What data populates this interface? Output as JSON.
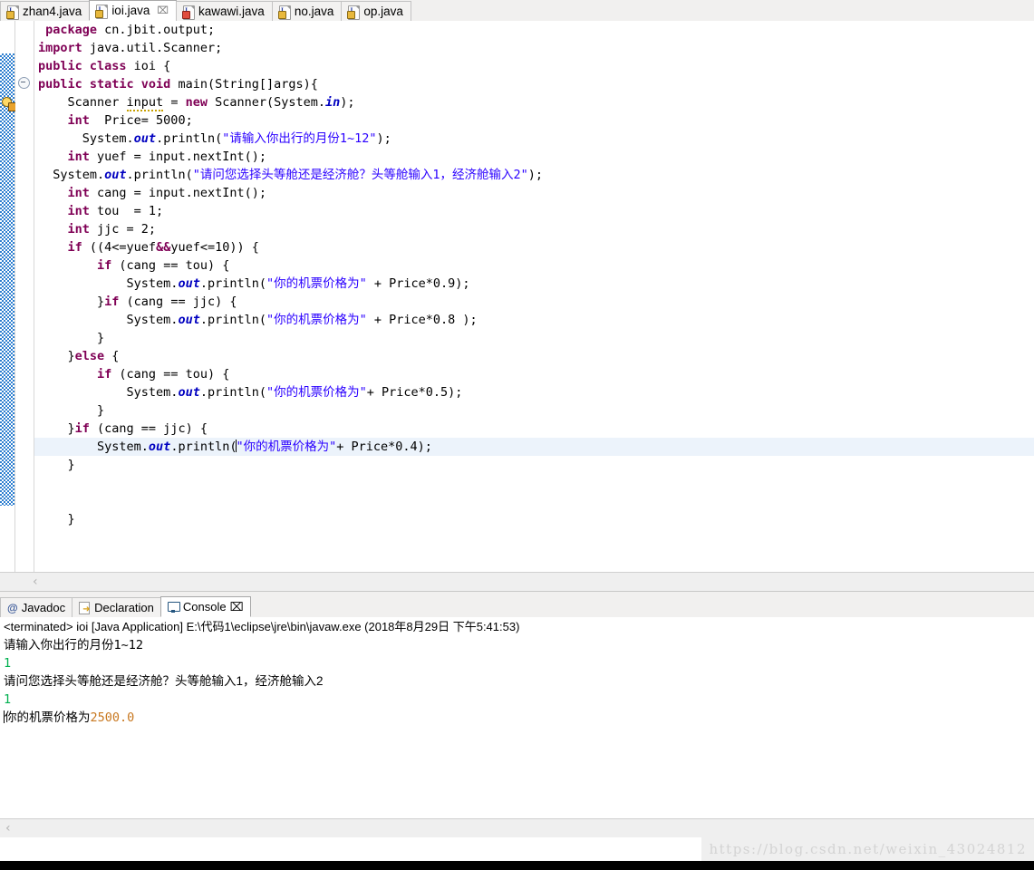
{
  "editor_tabs": [
    {
      "label": "zhan4.java",
      "icon": "java-file-icon",
      "badge": "warning",
      "active": false,
      "closable": false
    },
    {
      "label": "ioi.java",
      "icon": "java-file-icon",
      "badge": "warning",
      "active": true,
      "closable": true,
      "close_label": "⌧"
    },
    {
      "label": "kawawi.java",
      "icon": "java-file-icon",
      "badge": "error",
      "active": false,
      "closable": false
    },
    {
      "label": "no.java",
      "icon": "java-file-icon",
      "badge": "warning",
      "active": false,
      "closable": false
    },
    {
      "label": "op.java",
      "icon": "java-file-icon",
      "badge": "warning",
      "active": false,
      "closable": false
    }
  ],
  "code": {
    "lines": [
      " package cn.jbit.output;",
      "import java.util.Scanner;",
      "public class ioi {",
      "public static void main(String[]args){",
      "    Scanner input = new Scanner(System.in);",
      "    int  Price= 5000;",
      "      System.out.println(\"请输入你出行的月份1~12\");",
      "    int yuef = input.nextInt();",
      "  System.out.println(\"请问您选择头等舱还是经济舱？头等舱输入1，经济舱输入2\");",
      "    int cang = input.nextInt();",
      "    int tou  = 1;",
      "    int jjc = 2;",
      "    if ((4<=yuef&&yuef<=10)) {",
      "        if (cang == tou) {",
      "            System.out.println(\"你的机票价格为\" + Price*0.9);",
      "        }if (cang == jjc) {",
      "            System.out.println(\"你的机票价格为\" + Price*0.8 );",
      "        }",
      "    }else {",
      "        if (cang == tou) {",
      "            System.out.println(\"你的机票价格为\"+ Price*0.5);",
      "        }",
      "    }if (cang == jjc) {",
      "        System.out.println(\"你的机票价格为\"+ Price*0.4);",
      "    }",
      "",
      "",
      "    }"
    ],
    "highlighted_line_index": 23,
    "fold_marker": "⊖"
  },
  "panel_tabs": [
    {
      "label": "Javadoc",
      "icon": "javadoc-icon",
      "active": false,
      "closable": false
    },
    {
      "label": "Declaration",
      "icon": "declaration-icon",
      "active": false,
      "closable": false
    },
    {
      "label": "Console",
      "icon": "console-icon",
      "active": true,
      "closable": true,
      "close_label": "⌧"
    }
  ],
  "console": {
    "terminated_line": "<terminated> ioi [Java Application] E:\\代码1\\eclipse\\jre\\bin\\javaw.exe (2018年8月29日 下午5:41:53)",
    "output": [
      {
        "text": "请输入你出行的月份",
        "suffix": "1~12",
        "style": "plain"
      },
      {
        "text": "1",
        "style": "input"
      },
      {
        "text": "请问您选择头等舱还是经济舱？头等舱输入1，经济舱输入2",
        "style": "plain"
      },
      {
        "text": "1",
        "style": "input"
      },
      {
        "text": "你的机票价格为",
        "suffix": "2500.0",
        "style": "result"
      }
    ]
  },
  "scrollbars": {
    "editor_left_arrow": "‹",
    "console_left_arrow": "‹"
  },
  "watermark": {
    "text": "https://blog.csdn.net/weixin_43024812"
  },
  "colors": {
    "keyword": "#7f0055",
    "string": "#2a00ff",
    "field": "#0000c0",
    "highlight_row": "#ecf3fb",
    "console_input": "#00b04f",
    "console_result": "#c87820",
    "annotation_bar": "#2e7fd0"
  }
}
